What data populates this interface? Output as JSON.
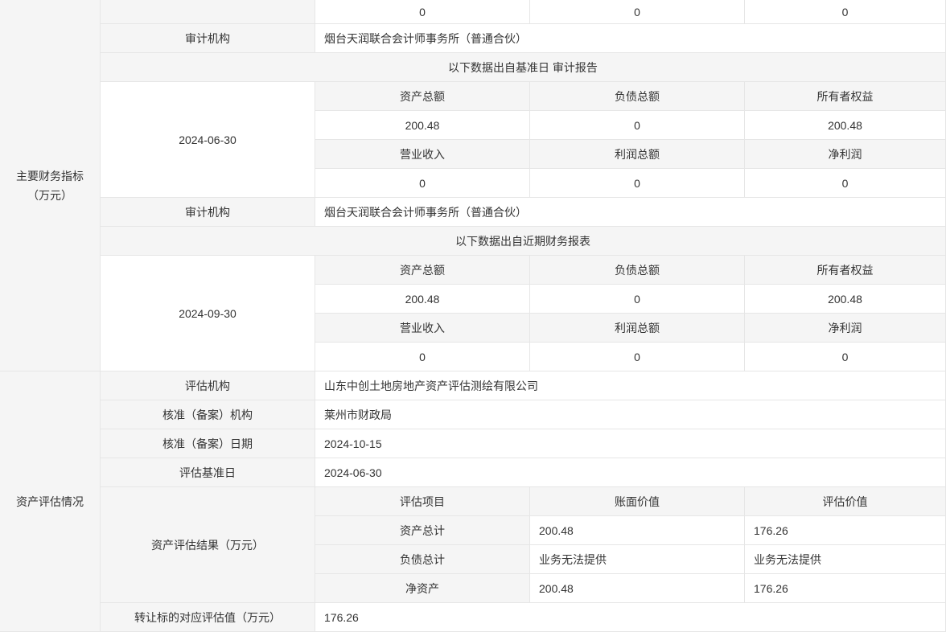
{
  "sections": {
    "financial": {
      "title": "主要财务指标",
      "unit": "（万元）"
    },
    "valuation": {
      "title": "资产评估情况"
    }
  },
  "top_row": {
    "c1": "0",
    "c2": "0",
    "c3": "0"
  },
  "audit_org_label": "审计机构",
  "audit_org_value_1": "烟台天润联合会计师事务所（普通合伙）",
  "block_a": {
    "caption": "以下数据出自基准日 审计报告",
    "date": "2024-06-30",
    "h1": {
      "c1": "资产总额",
      "c2": "负债总额",
      "c3": "所有者权益"
    },
    "v1": {
      "c1": "200.48",
      "c2": "0",
      "c3": "200.48"
    },
    "h2": {
      "c1": "营业收入",
      "c2": "利润总额",
      "c3": "净利润"
    },
    "v2": {
      "c1": "0",
      "c2": "0",
      "c3": "0"
    }
  },
  "audit_org_value_2": "烟台天润联合会计师事务所（普通合伙）",
  "block_b": {
    "caption": "以下数据出自近期财务报表",
    "date": "2024-09-30",
    "h1": {
      "c1": "资产总额",
      "c2": "负债总额",
      "c3": "所有者权益"
    },
    "v1": {
      "c1": "200.48",
      "c2": "0",
      "c3": "200.48"
    },
    "h2": {
      "c1": "营业收入",
      "c2": "利润总额",
      "c3": "净利润"
    },
    "v2": {
      "c1": "0",
      "c2": "0",
      "c3": "0"
    }
  },
  "valuation": {
    "org_label": "评估机构",
    "org_value": "山东中创土地房地产资产评估测绘有限公司",
    "approve_org_label": "核准（备案）机构",
    "approve_org_value": "莱州市财政局",
    "approve_date_label": "核准（备案）日期",
    "approve_date_value": "2024-10-15",
    "base_date_label": "评估基准日",
    "base_date_value": "2024-06-30",
    "result_label": "资产评估结果（万元）",
    "result_headers": {
      "c1": "评估项目",
      "c2": "账面价值",
      "c3": "评估价值"
    },
    "result_rows": [
      {
        "item": "资产总计",
        "book": "200.48",
        "appraised": "176.26"
      },
      {
        "item": "负债总计",
        "book": "业务无法提供",
        "appraised": "业务无法提供"
      },
      {
        "item": "净资产",
        "book": "200.48",
        "appraised": "176.26"
      }
    ],
    "transfer_label": "转让标的对应评估值（万元）",
    "transfer_value": "176.26"
  }
}
